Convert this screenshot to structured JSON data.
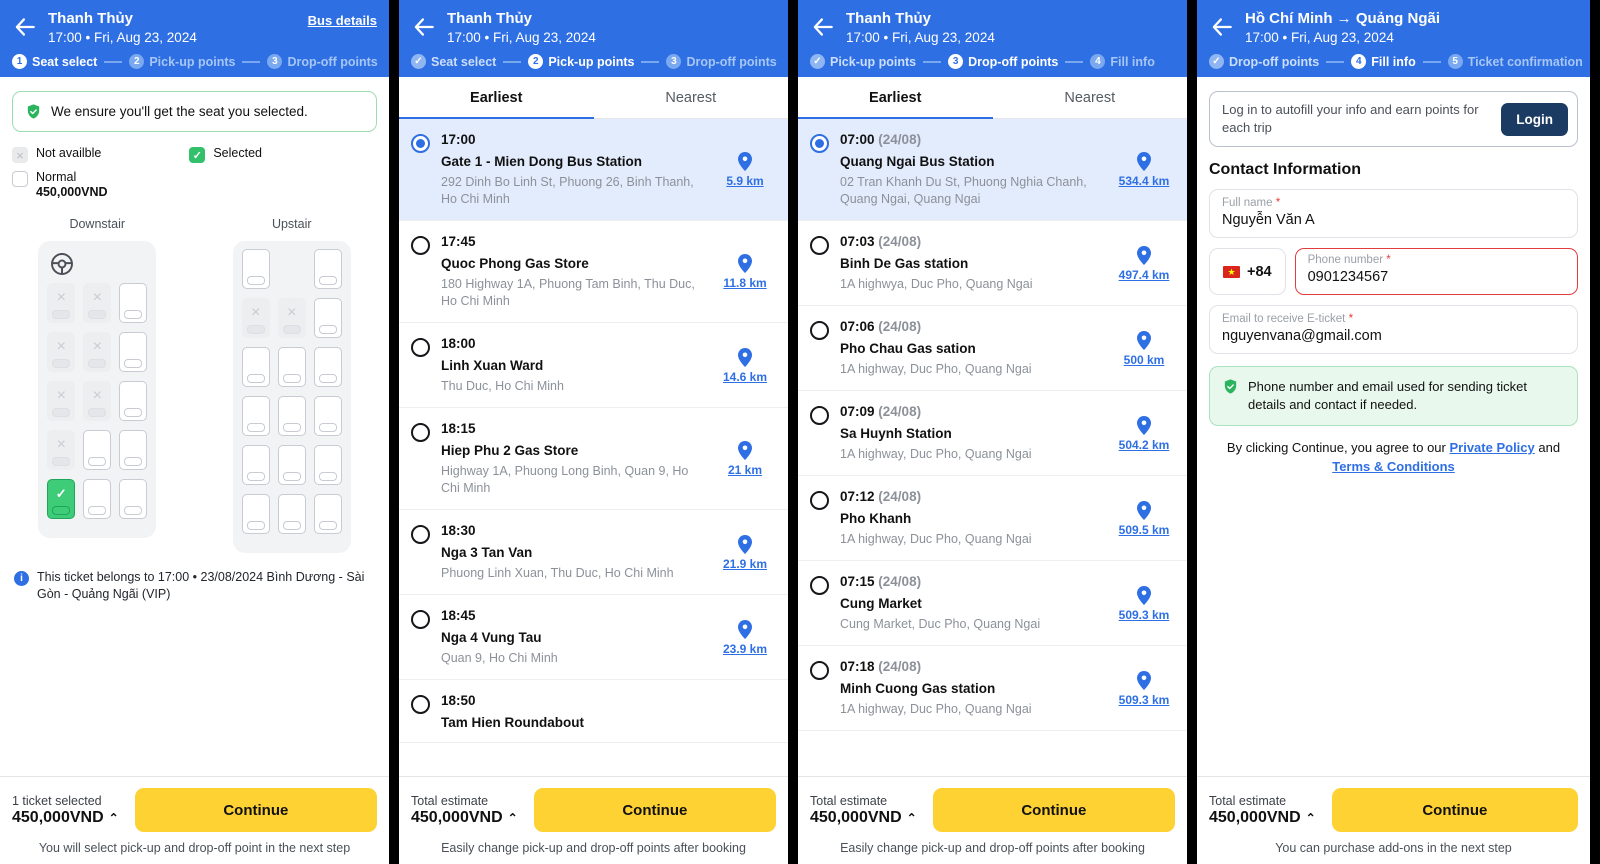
{
  "panels": [
    {
      "header": {
        "title": "Thanh Thủy",
        "subtitle": "17:00 • Fri, Aug 23, 2024",
        "action": "Bus details",
        "steps": [
          {
            "num": "1",
            "label": "Seat select",
            "state": "active"
          },
          {
            "num": "2",
            "label": "Pick-up points",
            "state": "todo"
          },
          {
            "num": "3",
            "label": "Drop-off points",
            "state": "todo"
          }
        ]
      },
      "ensure_text": "We ensure you'll get the seat you selected.",
      "legend": {
        "not_available": "Not availble",
        "selected": "Selected",
        "normal": "Normal",
        "normal_price": "450,000VND"
      },
      "decks": [
        {
          "title": "Downstair",
          "has_wheel": true,
          "rows": [
            [
              "x",
              "x",
              "normal"
            ],
            [
              "x",
              "x",
              "normal"
            ],
            [
              "x",
              "x",
              "normal"
            ],
            [
              "x",
              "normal",
              "normal"
            ],
            [
              "selected",
              "normal",
              "normal"
            ]
          ]
        },
        {
          "title": "Upstair",
          "has_wheel": false,
          "rows": [
            [
              "normal",
              "empty",
              "normal"
            ],
            [
              "x",
              "x",
              "normal"
            ],
            [
              "normal",
              "normal",
              "normal"
            ],
            [
              "normal",
              "normal",
              "normal"
            ],
            [
              "normal",
              "normal",
              "normal"
            ],
            [
              "normal",
              "normal",
              "normal"
            ]
          ]
        }
      ],
      "ticket_note": "This ticket belongs to 17:00 • 23/08/2024 Bình Dương - Sài Gòn - Quảng Ngãi (VIP)",
      "footer": {
        "caption": "1 ticket selected",
        "price": "450,000VND",
        "caret": "⌃",
        "continue": "Continue",
        "note": "You will select pick-up and drop-off point in the next step"
      }
    },
    {
      "header": {
        "title": "Thanh Thủy",
        "subtitle": "17:00 • Fri, Aug 23, 2024",
        "action": "",
        "steps": [
          {
            "num": "✓",
            "label": "Seat select",
            "state": "done"
          },
          {
            "num": "2",
            "label": "Pick-up points",
            "state": "active"
          },
          {
            "num": "3",
            "label": "Drop-off points",
            "state": "todo"
          }
        ]
      },
      "tabs": [
        {
          "label": "Earliest",
          "active": true
        },
        {
          "label": "Nearest",
          "active": false
        }
      ],
      "stops": [
        {
          "time": "17:00",
          "date": "",
          "name": "Gate 1 - Mien Dong Bus Station",
          "address": "292 Dinh Bo Linh St, Phuong 26, Binh Thanh, Ho Chi Minh",
          "distance": "5.9 km",
          "selected": true
        },
        {
          "time": "17:45",
          "date": "",
          "name": "Quoc Phong Gas Store",
          "address": "180 Highway 1A, Phuong Tam Binh, Thu Duc, Ho Chi Minh",
          "distance": "11.8 km",
          "selected": false
        },
        {
          "time": "18:00",
          "date": "",
          "name": "Linh Xuan Ward",
          "address": "Thu Duc, Ho Chi Minh",
          "distance": "14.6 km",
          "selected": false
        },
        {
          "time": "18:15",
          "date": "",
          "name": "Hiep Phu 2 Gas Store",
          "address": "Highway 1A, Phuong Long Binh, Quan 9, Ho Chi Minh",
          "distance": "21 km",
          "selected": false
        },
        {
          "time": "18:30",
          "date": "",
          "name": "Nga 3 Tan Van",
          "address": "Phuong Linh Xuan, Thu Duc, Ho Chi Minh",
          "distance": "21.9 km",
          "selected": false
        },
        {
          "time": "18:45",
          "date": "",
          "name": "Nga 4 Vung Tau",
          "address": "Quan 9, Ho Chi Minh",
          "distance": "23.9 km",
          "selected": false
        },
        {
          "time": "18:50",
          "date": "",
          "name": "Tam Hien Roundabout",
          "address": "",
          "distance": "",
          "selected": false
        }
      ],
      "footer": {
        "caption": "Total estimate",
        "price": "450,000VND",
        "caret": "⌃",
        "continue": "Continue",
        "note": "Easily change pick-up and drop-off points after booking"
      }
    },
    {
      "header": {
        "title": "Thanh Thủy",
        "subtitle": "17:00 • Fri, Aug 23, 2024",
        "action": "",
        "steps": [
          {
            "num": "✓",
            "label": "Pick-up points",
            "state": "done"
          },
          {
            "num": "3",
            "label": "Drop-off points",
            "state": "active"
          },
          {
            "num": "4",
            "label": "Fill info",
            "state": "todo"
          }
        ]
      },
      "tabs": [
        {
          "label": "Earliest",
          "active": true
        },
        {
          "label": "Nearest",
          "active": false
        }
      ],
      "stops": [
        {
          "time": "07:00",
          "date": "(24/08)",
          "name": "Quang Ngai Bus Station",
          "address": "02 Tran Khanh Du St, Phuong Nghia Chanh, Quang Ngai, Quang Ngai",
          "distance": "534.4 km",
          "selected": true
        },
        {
          "time": "07:03",
          "date": "(24/08)",
          "name": "Binh De Gas station",
          "address": "1A highwya, Duc Pho, Quang Ngai",
          "distance": "497.4 km",
          "selected": false
        },
        {
          "time": "07:06",
          "date": "(24/08)",
          "name": "Pho Chau Gas sation",
          "address": "1A highway, Duc Pho, Quang Ngai",
          "distance": "500 km",
          "selected": false
        },
        {
          "time": "07:09",
          "date": "(24/08)",
          "name": "Sa Huynh Station",
          "address": "1A highway, Duc Pho, Quang Ngai",
          "distance": "504.2 km",
          "selected": false
        },
        {
          "time": "07:12",
          "date": "(24/08)",
          "name": "Pho Khanh",
          "address": "1A highway, Duc Pho, Quang Ngai",
          "distance": "509.5 km",
          "selected": false
        },
        {
          "time": "07:15",
          "date": "(24/08)",
          "name": "Cung Market",
          "address": "Cung Market, Duc Pho, Quang Ngai",
          "distance": "509.3 km",
          "selected": false
        },
        {
          "time": "07:18",
          "date": "(24/08)",
          "name": "Minh Cuong Gas station",
          "address": "1A highway, Duc Pho, Quang Ngai",
          "distance": "509.3 km",
          "selected": false
        }
      ],
      "footer": {
        "caption": "Total estimate",
        "price": "450,000VND",
        "caret": "⌃",
        "continue": "Continue",
        "note": "Easily change pick-up and drop-off points after booking"
      }
    },
    {
      "header": {
        "title": "Hồ Chí Minh → Quảng Ngãi",
        "subtitle": "17:00 • Fri, Aug 23, 2024",
        "action": "",
        "steps": [
          {
            "num": "✓",
            "label": "Drop-off points",
            "state": "done"
          },
          {
            "num": "4",
            "label": "Fill info",
            "state": "active"
          },
          {
            "num": "5",
            "label": "Ticket confirmation",
            "state": "todo"
          }
        ]
      },
      "login": {
        "text": "Log in to autofill your info and earn points for each trip",
        "button": "Login"
      },
      "contact_title": "Contact Information",
      "fields": {
        "full_name_label": "Full name",
        "full_name_value": "Nguyễn Văn A",
        "country_code": "+84",
        "phone_label": "Phone number",
        "phone_value": "0901234567",
        "email_label": "Email to receive E-ticket",
        "email_value": "nguyenvana@gmail.com",
        "required_mark": "*"
      },
      "green_note": "Phone number and email used for sending ticket details and contact if needed.",
      "terms": {
        "prefix": "By clicking Continue, you agree to our ",
        "link1": "Private Policy",
        "mid": " and ",
        "link2": "Terms & Conditions"
      },
      "footer": {
        "caption": "Total estimate",
        "price": "450,000VND",
        "caret": "⌃",
        "continue": "Continue",
        "note": "You can purchase add-ons in the next step"
      }
    }
  ],
  "colors": {
    "brand_blue": "#2f6fe4",
    "accent_yellow": "#ffd233",
    "success_green": "#32c06a",
    "error_red": "#e23d3d",
    "login_navy": "#1c3b63"
  }
}
